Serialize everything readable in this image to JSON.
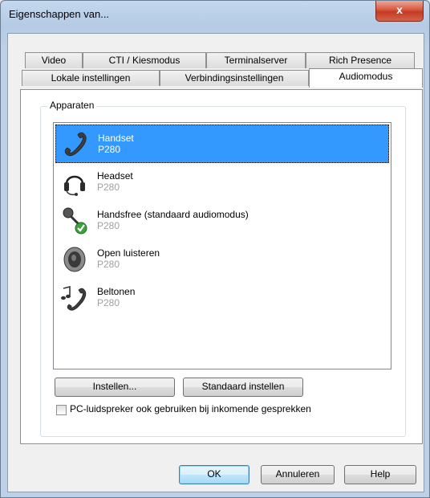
{
  "window": {
    "title": "Eigenschappen van...",
    "close_glyph": "x"
  },
  "tabs": {
    "row1": [
      "Video",
      "CTI / Kiesmodus",
      "Terminalserver",
      "Rich Presence"
    ],
    "row2": [
      "Lokale instellingen",
      "Verbindingsinstellingen",
      "Audiomodus"
    ],
    "active": "Audiomodus"
  },
  "group": {
    "label": "Apparaten"
  },
  "devices": [
    {
      "name": "Handset",
      "sub": "P280",
      "icon": "handset-icon",
      "selected": true
    },
    {
      "name": "Headset",
      "sub": "P280",
      "icon": "headset-icon",
      "selected": false
    },
    {
      "name": "Handsfree (standaard audiomodus)",
      "sub": "P280",
      "icon": "microphone-check-icon",
      "selected": false
    },
    {
      "name": "Open luisteren",
      "sub": "P280",
      "icon": "speaker-icon",
      "selected": false
    },
    {
      "name": "Beltonen",
      "sub": "P280",
      "icon": "ringtone-icon",
      "selected": false
    }
  ],
  "buttons": {
    "configure": "Instellen...",
    "set_default": "Standaard instellen",
    "ok": "OK",
    "cancel": "Annuleren",
    "help": "Help"
  },
  "checkbox": {
    "label": "PC-luidspreker ook gebruiken bij inkomende gesprekken",
    "checked": false
  },
  "colors": {
    "selection": "#3399ff",
    "accent": "#c33b22"
  }
}
